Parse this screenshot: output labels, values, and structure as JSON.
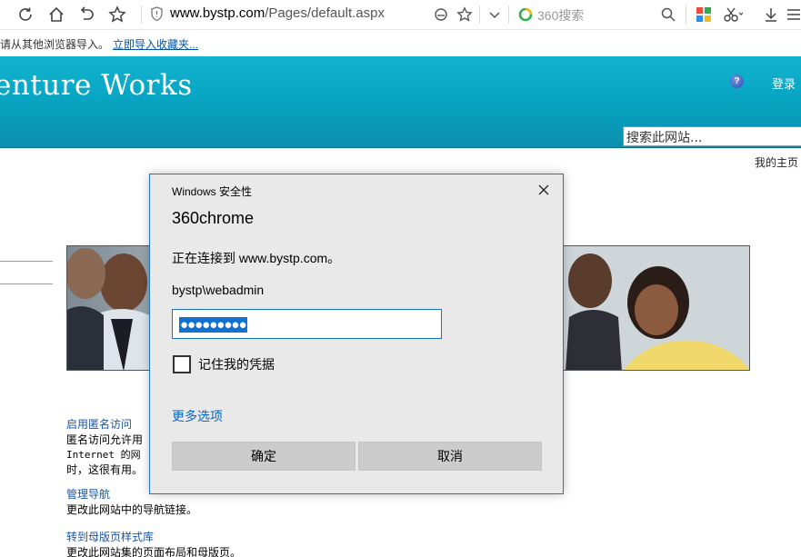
{
  "browser": {
    "url_domain": "www.bystp.com",
    "url_path": "/Pages/default.aspx",
    "search_placeholder": "360搜索",
    "icons": [
      "refresh-icon",
      "home-icon",
      "undo-icon",
      "star-icon",
      "shield-icon",
      "compat-icon",
      "favorite-icon",
      "chevron-down-icon",
      "360-search-icon",
      "magnifier-icon",
      "apps-icon",
      "scissors-icon",
      "download-icon",
      "menu-icon"
    ]
  },
  "favorites_bar": {
    "text": "请从其他浏览器导入。",
    "link": "立即导入收藏夹..."
  },
  "site": {
    "title": "enture Works",
    "help": "?",
    "login": "登录",
    "search_placeholder": "搜索此网站...",
    "my_home": "我的主页",
    "header_color": "#0aa8c6"
  },
  "content": {
    "anon_link": "启用匿名访问",
    "anon_line1": "匿名访问允许用",
    "anon_line2": "Internet 的网",
    "anon_line3": "时，这很有用。",
    "nav_link": "管理导航",
    "nav_desc": "更改此网站中的导航链接。",
    "master_link": "转到母版页样式库",
    "master_desc": "更改此网站集的页面布局和母版页。"
  },
  "dialog": {
    "caption": "Windows 安全性",
    "heading": "360chrome",
    "connecting": "正在连接到 www.bystp.com。",
    "username": "bystp\\webadmin",
    "password_masked": "●●●●●●●●●",
    "remember_label": "记住我的凭据",
    "remember_checked": false,
    "more_options": "更多选项",
    "ok_label": "确定",
    "cancel_label": "取消",
    "accent_color": "#1d78c9"
  }
}
